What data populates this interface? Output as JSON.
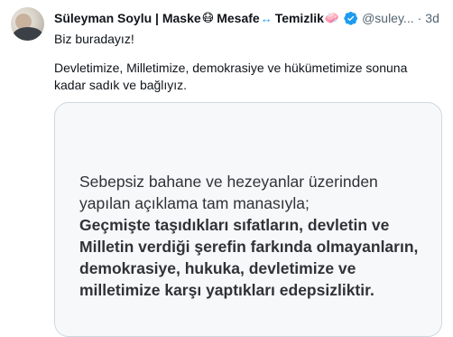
{
  "author": {
    "name": "Süleyman Soylu | Maske",
    "emoji_mask": "😷",
    "mesafe": "Mesafe",
    "emoji_arrow": "↔",
    "temizlik": "Temizlik",
    "emoji_soap": "🧼",
    "handle": "@suley...",
    "separator": "·",
    "time": "3d",
    "verified_color": "#1d9bf0"
  },
  "tweet": {
    "line1": "Biz buradayız!",
    "line2": "Devletimize, Milletimize, demokrasiye ve hükümetimize sonuna kadar sadık ve bağlıyız."
  },
  "quote_card": {
    "line_regular_1": "Sebepsiz bahane ve hezeyanlar üzerinden",
    "line_regular_2": "yapılan açıklama tam manasıyla;",
    "line_bold_1": "Geçmişte taşıdıkları sıfatların, devletin ve",
    "line_bold_2": "Milletin verdiği şerefin farkında olmayanların,",
    "line_bold_3": "demokrasiye, hukuka, devletimize ve",
    "line_bold_4": "milletimize karşı yaptıkları edepsizliktir."
  }
}
